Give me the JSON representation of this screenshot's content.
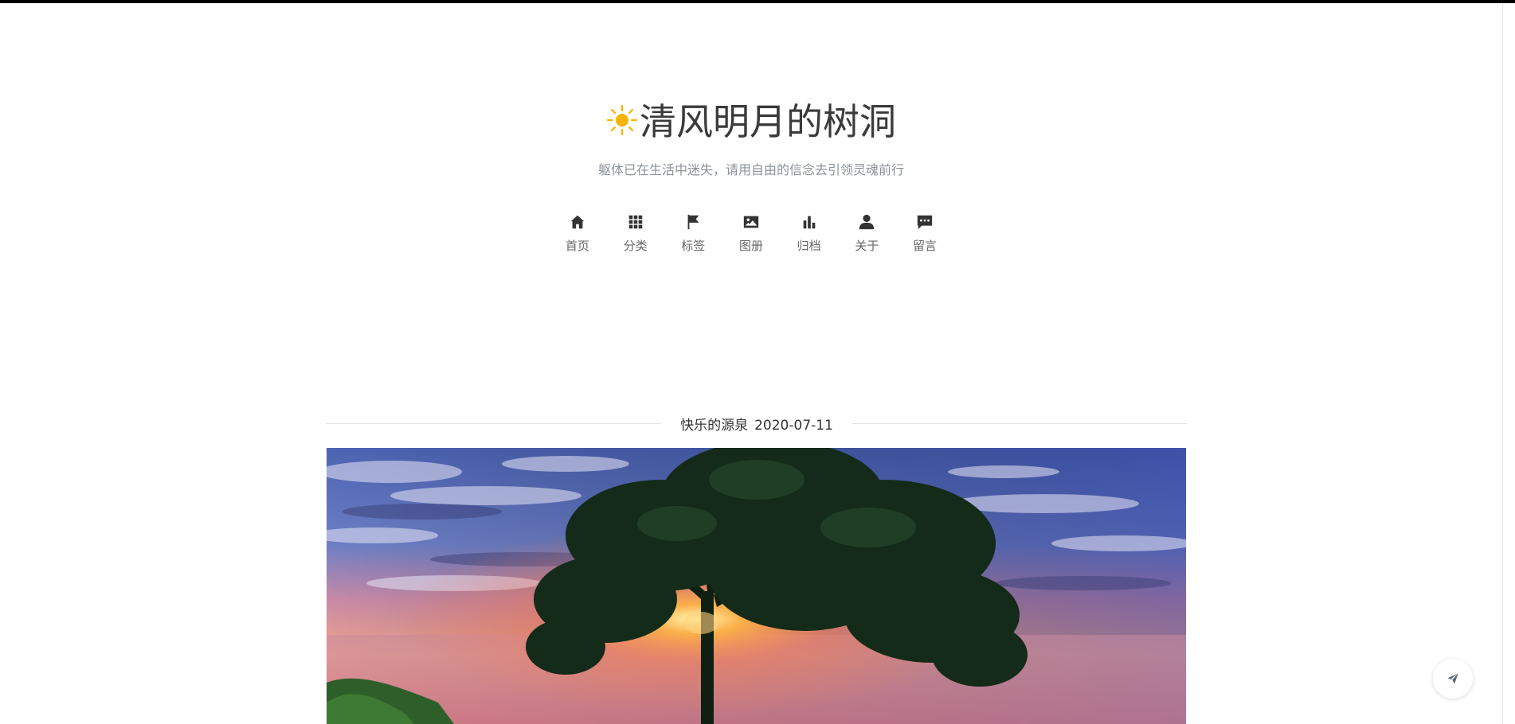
{
  "site": {
    "title": "清风明月的树洞",
    "subtitle": "躯体已在生活中迷失，请用自由的信念去引领灵魂前行",
    "logo_icon": "sun-icon",
    "logo_color": "#f5b400"
  },
  "nav": {
    "items": [
      {
        "label": "首页",
        "icon": "home-icon"
      },
      {
        "label": "分类",
        "icon": "grid-icon"
      },
      {
        "label": "标签",
        "icon": "flag-icon"
      },
      {
        "label": "图册",
        "icon": "image-icon"
      },
      {
        "label": "归档",
        "icon": "bar-chart-icon"
      },
      {
        "label": "关于",
        "icon": "user-icon"
      },
      {
        "label": "留言",
        "icon": "comment-icon"
      }
    ]
  },
  "post": {
    "title": "快乐的源泉",
    "date": "2020-07-11",
    "image": "sunset-tree-lake-photo"
  },
  "fab": {
    "icon": "paper-plane-icon"
  },
  "colors": {
    "text": "#333333",
    "muted": "#8c9299",
    "accent": "#f5b400"
  }
}
